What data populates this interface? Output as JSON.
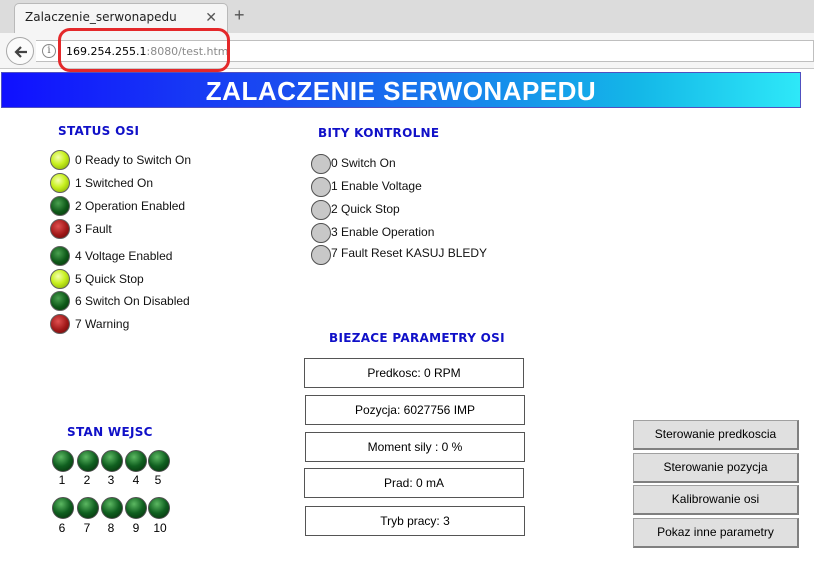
{
  "browser": {
    "tab_title": "Zalaczenie_serwonapedu",
    "close_glyph": "✕",
    "newtab_glyph": "+",
    "info_glyph": "i",
    "url_host": "169.254.255.1",
    "url_rest": ":8080/test.htm"
  },
  "page": {
    "banner_title": "ZALACZENIE SERWONAPEDU"
  },
  "status_osi": {
    "title": "STATUS OSI",
    "items": [
      {
        "label": "0 Ready to Switch On",
        "state": "lime"
      },
      {
        "label": "1 Switched On",
        "state": "lime"
      },
      {
        "label": "2 Operation Enabled",
        "state": "dark-green"
      },
      {
        "label": "3 Fault",
        "state": "red"
      },
      {
        "label": "4 Voltage Enabled",
        "state": "dark-green"
      },
      {
        "label": "5 Quick Stop",
        "state": "lime"
      },
      {
        "label": "6 Switch On Disabled",
        "state": "dark-green"
      },
      {
        "label": "7 Warning",
        "state": "red"
      }
    ]
  },
  "bity_kontrolne": {
    "title": "BITY KONTROLNE",
    "items": [
      {
        "label": "0 Switch On",
        "state": "grey"
      },
      {
        "label": "1 Enable Voltage",
        "state": "grey"
      },
      {
        "label": "2 Quick Stop",
        "state": "grey"
      },
      {
        "label": "3 Enable Operation",
        "state": "grey"
      },
      {
        "label": "7 Fault Reset KASUJ BLEDY",
        "state": "grey"
      }
    ]
  },
  "parametry": {
    "title": "BIEZACE PARAMETRY OSI",
    "items": [
      "Predkosc: 0 RPM",
      "Pozycja: 6027756 IMP",
      "Moment sily : 0 %",
      "Prad: 0 mA",
      "Tryb pracy: 3"
    ]
  },
  "stan_wejsc": {
    "title": "STAN WEJSC",
    "inputs": [
      "1",
      "2",
      "3",
      "4",
      "5",
      "6",
      "7",
      "8",
      "9",
      "10"
    ]
  },
  "buttons": [
    "Sterowanie predkoscia",
    "Sterowanie pozycja",
    "Kalibrowanie osi",
    "Pokaz inne parametry"
  ],
  "colors": {
    "section_title": "#1010c8",
    "url_highlight": "#e4282a",
    "led_lime": "#c8f020",
    "led_dark_green": "#0e5818",
    "led_red": "#a01818",
    "led_grey": "#c8c8c8"
  }
}
